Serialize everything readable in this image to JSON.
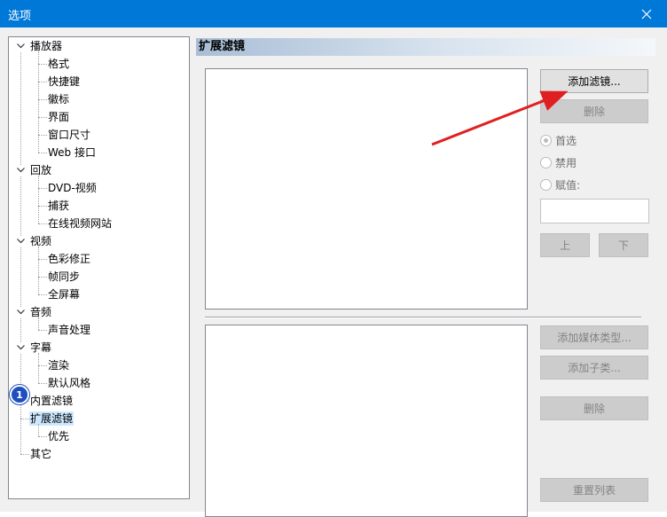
{
  "window": {
    "title": "选项",
    "close_icon": "close-icon"
  },
  "tree": {
    "badge": "1",
    "items": [
      {
        "label": "播放器",
        "level": 0,
        "expanded": true
      },
      {
        "label": "格式",
        "level": 1
      },
      {
        "label": "快捷键",
        "level": 1
      },
      {
        "label": "徽标",
        "level": 1
      },
      {
        "label": "界面",
        "level": 1
      },
      {
        "label": "窗口尺寸",
        "level": 1
      },
      {
        "label": "Web 接口",
        "level": 1
      },
      {
        "label": "回放",
        "level": 0,
        "expanded": true
      },
      {
        "label": "DVD-视频",
        "level": 1
      },
      {
        "label": "捕获",
        "level": 1
      },
      {
        "label": "在线视频网站",
        "level": 1
      },
      {
        "label": "视频",
        "level": 0,
        "expanded": true
      },
      {
        "label": "色彩修正",
        "level": 1
      },
      {
        "label": "帧同步",
        "level": 1
      },
      {
        "label": "全屏幕",
        "level": 1
      },
      {
        "label": "音频",
        "level": 0,
        "expanded": true
      },
      {
        "label": "声音处理",
        "level": 1
      },
      {
        "label": "字幕",
        "level": 0,
        "expanded": true
      },
      {
        "label": "渲染",
        "level": 1
      },
      {
        "label": "默认风格",
        "level": 1
      },
      {
        "label": "内置滤镜",
        "level": 0
      },
      {
        "label": "扩展滤镜",
        "level": 0,
        "selected": true
      },
      {
        "label": "优先",
        "level": 1
      },
      {
        "label": "其它",
        "level": 0
      }
    ]
  },
  "panel": {
    "header": "扩展滤镜",
    "add_filter": "添加滤镜...",
    "delete": "删除",
    "radios": {
      "prefer": "首选",
      "block": "禁用",
      "merit": "赋值:"
    },
    "up": "上",
    "down": "下",
    "add_media_type": "添加媒体类型...",
    "add_subtype": "添加子类...",
    "delete2": "删除",
    "reset_list": "重置列表"
  },
  "colors": {
    "titlebar": "#0078d7",
    "selection": "#cce8ff",
    "arrow": "#e02020",
    "badge": "#1f4fbf"
  }
}
